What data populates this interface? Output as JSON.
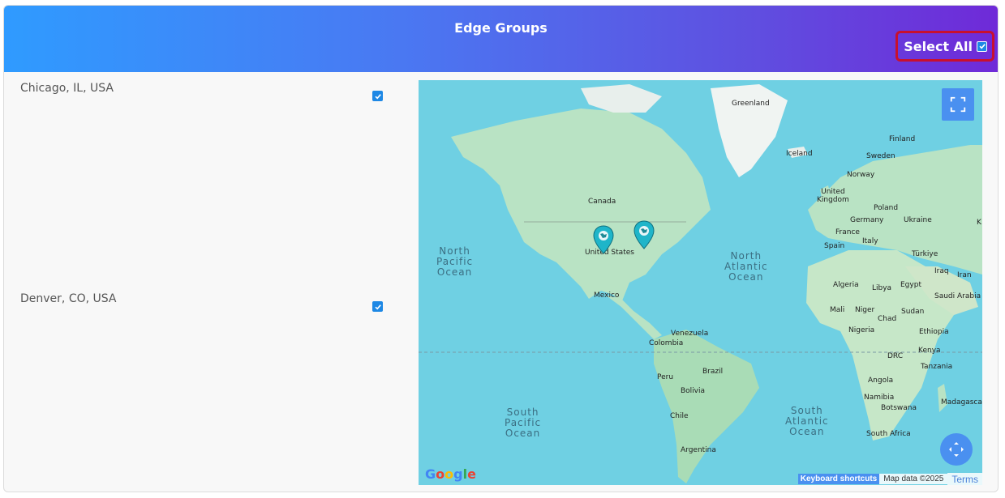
{
  "header": {
    "title": "Edge Groups",
    "select_all_label": "Select All",
    "select_all_checked": true
  },
  "locations": [
    {
      "label": "Chicago, IL, USA",
      "checked": true
    },
    {
      "label": "Denver, CO, USA",
      "checked": true
    }
  ],
  "map": {
    "oceans": {
      "north_pacific": "North\nPacific\nOcean",
      "north_atlantic": "North\nAtlantic\nOcean",
      "south_pacific": "South\nPacific\nOcean",
      "south_atlantic": "South\nAtlantic\nOcean"
    },
    "countries": {
      "greenland": "Greenland",
      "iceland": "Iceland",
      "finland": "Finland",
      "sweden": "Sweden",
      "norway": "Norway",
      "uk": "United\nKingdom",
      "poland": "Poland",
      "germany": "Germany",
      "ukraine": "Ukraine",
      "france": "France",
      "italy": "Italy",
      "spain": "Spain",
      "turkiye": "Türkiye",
      "iraq": "Iraq",
      "iran": "Iran",
      "algeria": "Algeria",
      "libya": "Libya",
      "egypt": "Egypt",
      "saudi": "Saudi Arabia",
      "mali": "Mali",
      "niger": "Niger",
      "sudan": "Sudan",
      "chad": "Chad",
      "nigeria": "Nigeria",
      "ethiopia": "Ethiopia",
      "kenya": "Kenya",
      "drc": "DRC",
      "tanzania": "Tanzania",
      "angola": "Angola",
      "namibia": "Namibia",
      "botswana": "Botswana",
      "madagascar": "Madagascar",
      "south_africa": "South Africa",
      "canada": "Canada",
      "usa": "United States",
      "mexico": "Mexico",
      "venezuela": "Venezuela",
      "colombia": "Colombia",
      "peru": "Peru",
      "brazil": "Brazil",
      "bolivia": "Bolivia",
      "chile": "Chile",
      "argentina": "Argentina",
      "kaz": "K"
    },
    "google": "Google",
    "keyboard_shortcuts": "Keyboard shortcuts",
    "map_data": "Map data ©2025",
    "terms": "Terms",
    "colors": {
      "ocean": "#6fd0e3",
      "land": "#b9e3c4",
      "marker": "#1fb5c9",
      "button": "#4a90f0"
    }
  }
}
